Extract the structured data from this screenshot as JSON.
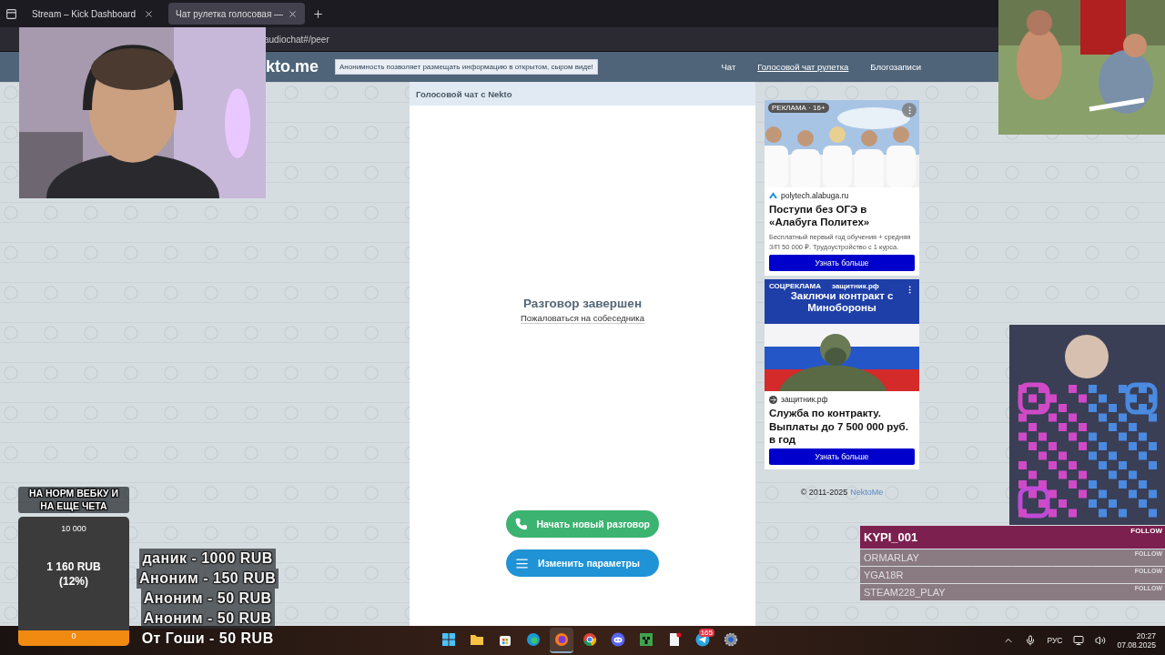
{
  "browser": {
    "tabs": [
      {
        "title": "Stream – Kick Dashboard",
        "selected": false
      },
      {
        "title": "Чат рулетка голосовая —",
        "selected": true
      }
    ],
    "address": "audiochat#/peer"
  },
  "site": {
    "logo": "kto.me",
    "notice": "Анонимность позволяет размещать информацию в открытом, сыром виде!",
    "nav": [
      {
        "label": "Чат",
        "selected": false
      },
      {
        "label": "Голосовой чат рулетка",
        "selected": true
      },
      {
        "label": "Блогозаписи",
        "selected": false
      }
    ]
  },
  "chat": {
    "title": "Голосовой чат с Nekto",
    "status": "Разговор завершен",
    "report_link": "Пожаловаться на собеседника",
    "buttons": [
      {
        "label": "Начать новый разговор",
        "kind": "start"
      },
      {
        "label": "Изменить параметры",
        "kind": "settings"
      }
    ]
  },
  "ads": [
    {
      "badge": "РЕКЛАМА · 16+",
      "domain": "polytech.alabuga.ru",
      "title": "Поступи без ОГЭ в «Алабуга Политех»",
      "text": "Бесплатный первый год обучения + средняя З/П 50 000 ₽. Трудоустройство с 1 курса.",
      "button": "Узнать больше"
    },
    {
      "kind": "banner",
      "banner_label": "СОЦРЕКЛАМА",
      "banner_site": "защитник.рф",
      "banner_title": "Заключи контракт с Минобороны",
      "domain": "защитник.рф",
      "title": "Служба по контракту. Выплаты до 7 500 000 руб. в год",
      "button": "Узнать больше"
    }
  ],
  "footer": {
    "copyright": "© 2011-2025",
    "link": "NektoMe"
  },
  "overlay": {
    "goal": {
      "title": "НА НОРМ ВЕБКУ И НА ЕЩЕ ЧЕТА",
      "max": "10 000",
      "amount": "1 160 RUB",
      "percent": "(12%)",
      "min": "0",
      "level": 0.12
    },
    "donations": [
      "даник - 1000 RUB",
      "Аноним - 150 RUB",
      "Аноним - 50 RUB",
      "Аноним - 50 RUB",
      "От Гоши - 50 RUB"
    ],
    "followers": [
      {
        "name": "KYPI_001",
        "action": "FOLLOW",
        "selected": true
      },
      {
        "name": "ORMARLAY",
        "action": "FOLLOW",
        "selected": false
      },
      {
        "name": "YGA18R",
        "action": "FOLLOW",
        "selected": false
      },
      {
        "name": "STEAM228_PLAY",
        "action": "FOLLOW",
        "selected": false
      }
    ]
  },
  "taskbar": {
    "apps": [
      {
        "kind": "start",
        "selected": false
      },
      {
        "kind": "folder",
        "selected": false
      },
      {
        "kind": "store",
        "selected": false
      },
      {
        "kind": "edge",
        "selected": false
      },
      {
        "kind": "firefox",
        "selected": true
      },
      {
        "kind": "chrome",
        "selected": false
      },
      {
        "kind": "discord",
        "selected": false
      },
      {
        "kind": "minecraft",
        "selected": false
      },
      {
        "kind": "notepad",
        "selected": false
      },
      {
        "kind": "telegram",
        "selected": false,
        "badge": "165"
      },
      {
        "kind": "settings",
        "selected": false
      }
    ],
    "language": "РУС",
    "time": "20:27",
    "date": "07.08.2025"
  }
}
